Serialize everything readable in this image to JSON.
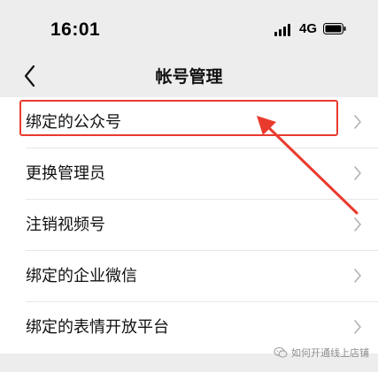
{
  "status_bar": {
    "time": "16:01",
    "network": "4G",
    "signal_icon": "signal-bars-icon",
    "battery_icon": "battery-icon"
  },
  "nav": {
    "title": "帐号管理",
    "back_icon": "chevron-left-icon"
  },
  "settings_items": [
    {
      "label": "绑定的公众号",
      "highlighted": true
    },
    {
      "label": "更换管理员",
      "highlighted": false
    },
    {
      "label": "注销视频号",
      "highlighted": false
    },
    {
      "label": "绑定的企业微信",
      "highlighted": false
    },
    {
      "label": "绑定的表情开放平台",
      "highlighted": false
    }
  ],
  "annotation": {
    "color": "#ea3a2e"
  },
  "watermark": {
    "text": "如何开通线上店铺",
    "icon": "wechat-bubble-icon"
  }
}
